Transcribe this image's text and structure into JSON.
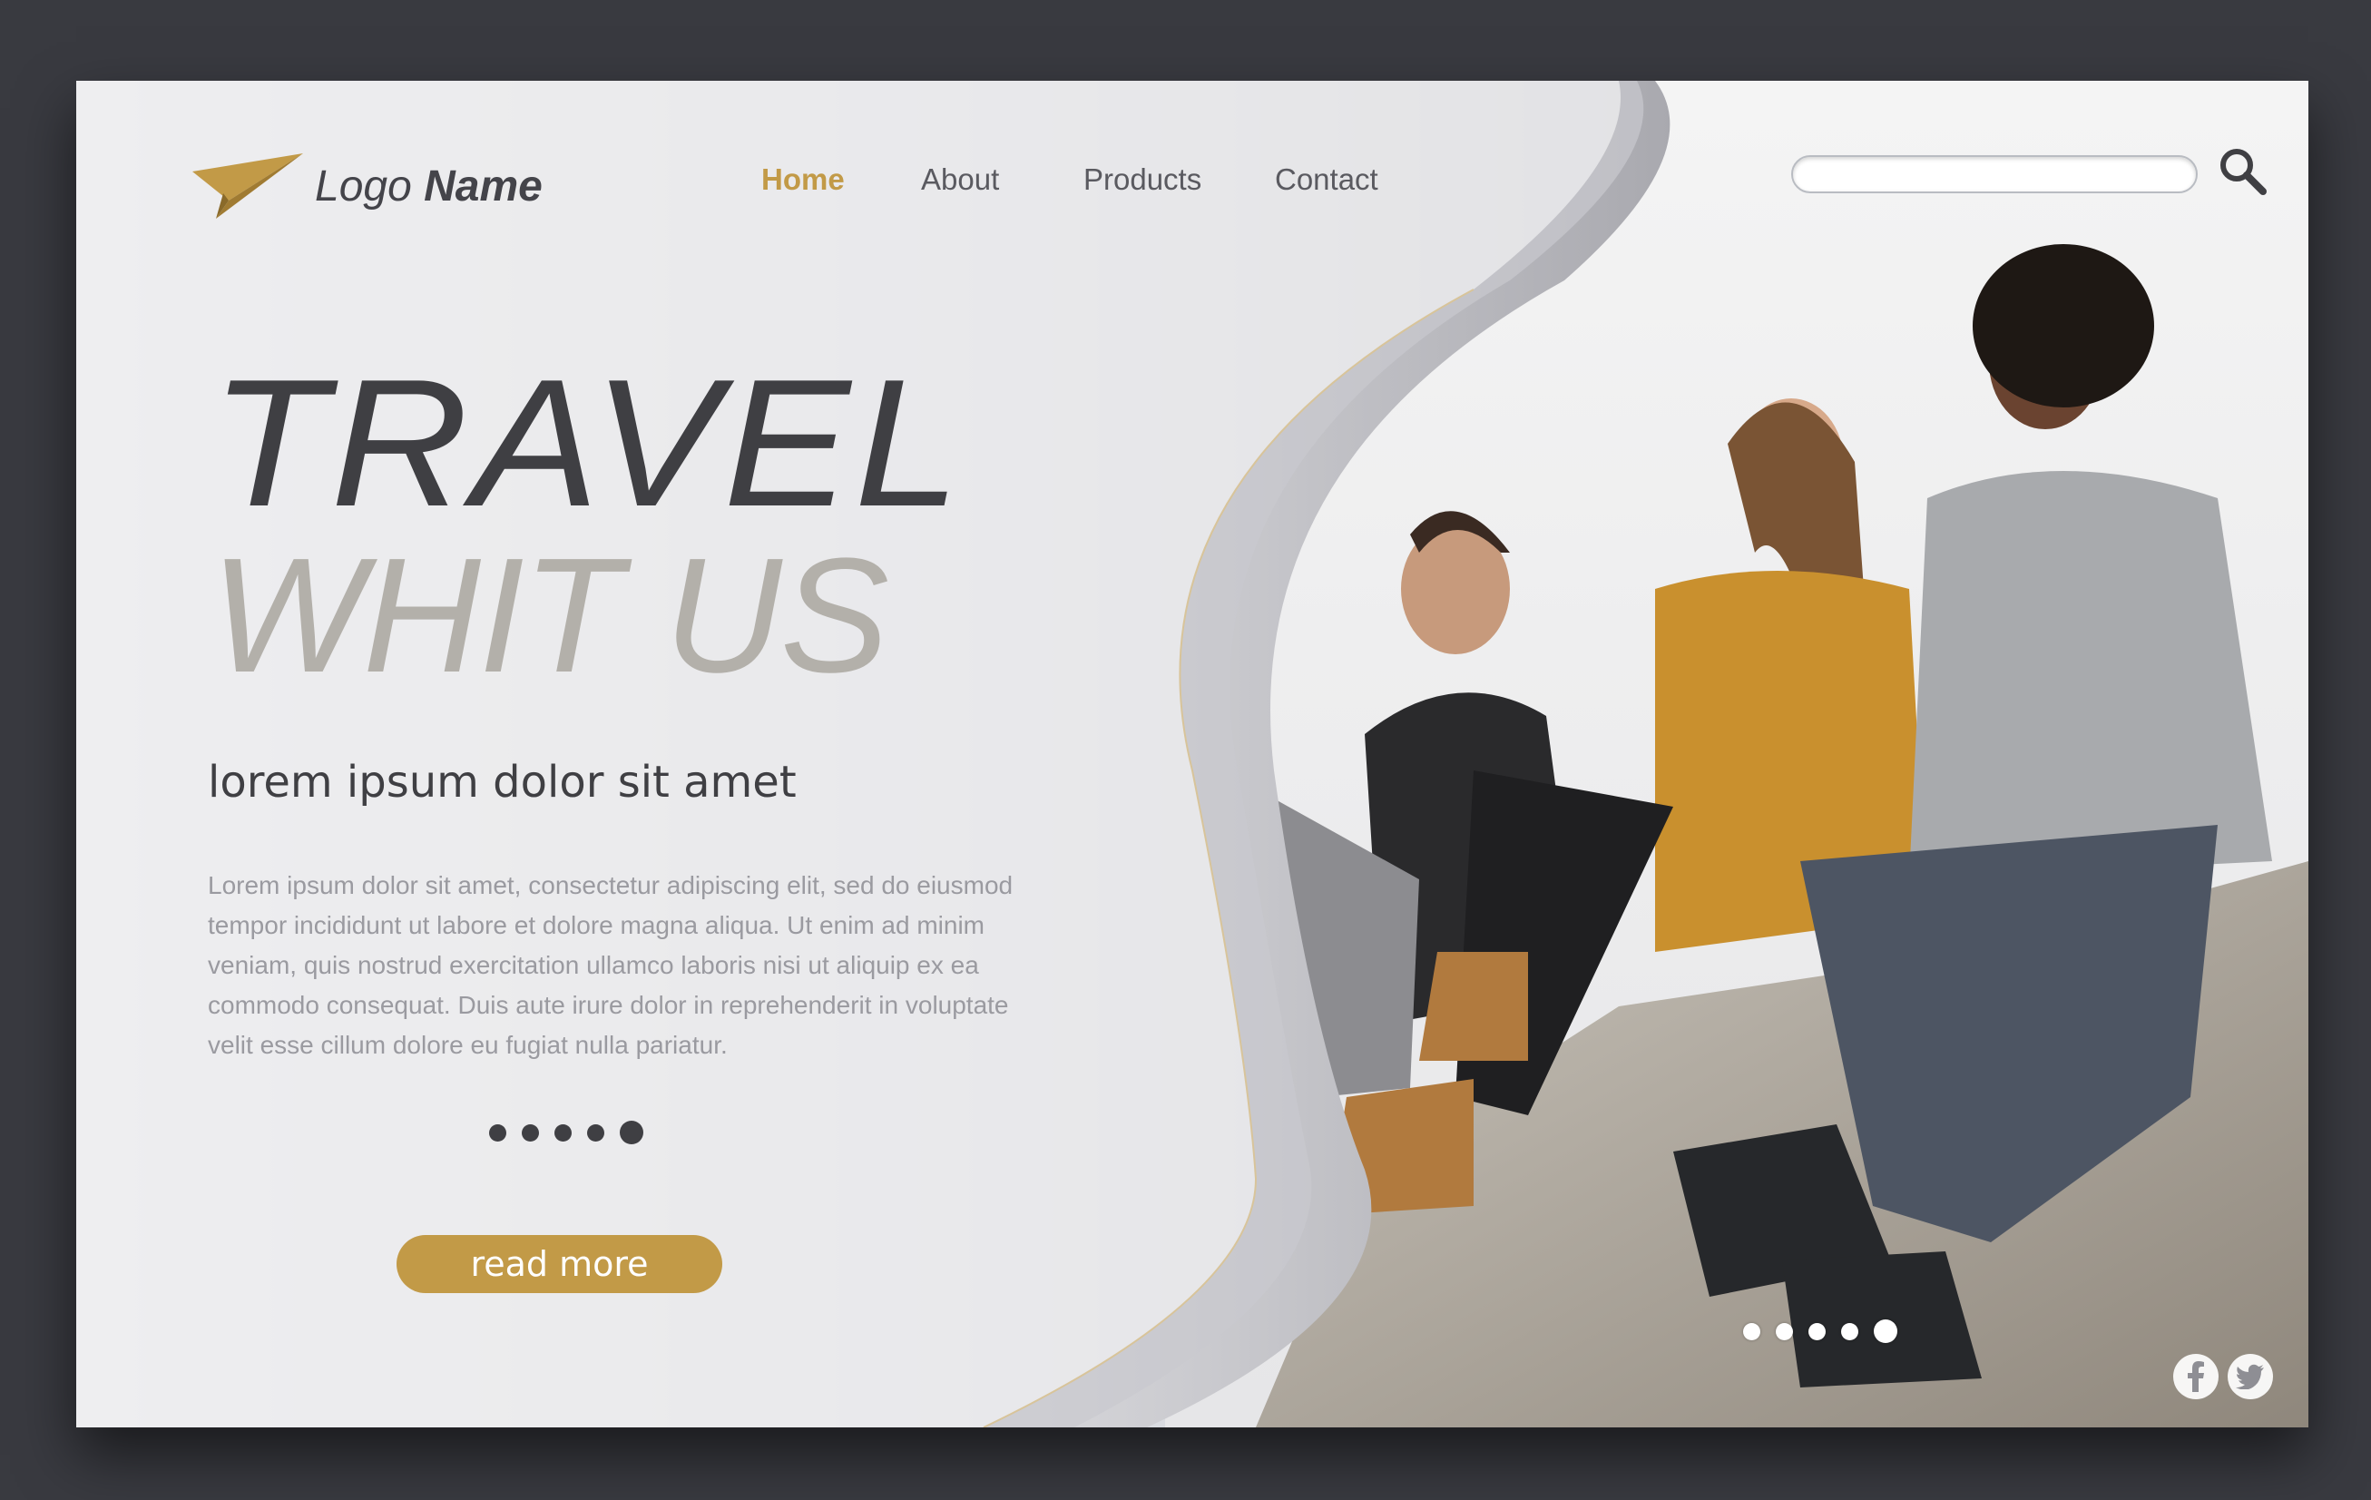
{
  "logo": {
    "word1": "Logo",
    "word2": "Name",
    "icon": "paper-plane-icon"
  },
  "nav": {
    "items": [
      {
        "label": "Home",
        "active": true
      },
      {
        "label": "About",
        "active": false
      },
      {
        "label": "Products",
        "active": false
      },
      {
        "label": "Contact",
        "active": false
      }
    ]
  },
  "search": {
    "placeholder": "",
    "icon": "search-icon"
  },
  "hero": {
    "title_line1": "TRAVEL",
    "title_line2": "WHIT US",
    "subtitle": "lorem ipsum dolor sit amet",
    "body": "Lorem ipsum dolor sit amet, consectetur adipiscing elit, sed do eiusmod tempor incididunt ut labore et dolore magna aliqua. Ut enim ad minim veniam, quis nostrud exercitation ullamco laboris nisi ut aliquip ex ea commodo consequat. Duis aute irure dolor in reprehenderit in voluptate velit esse cillum dolore eu fugiat nulla pariatur.",
    "cta_label": "read more",
    "slider_count": 5,
    "slider_active": 5
  },
  "photo_slider": {
    "count": 5,
    "active": 5
  },
  "social": {
    "icons": [
      "facebook-icon",
      "twitter-icon"
    ]
  },
  "colors": {
    "accent": "#c29a47",
    "dark": "#3f3f43",
    "muted": "#b3b0aa",
    "frame": "#393a40"
  }
}
